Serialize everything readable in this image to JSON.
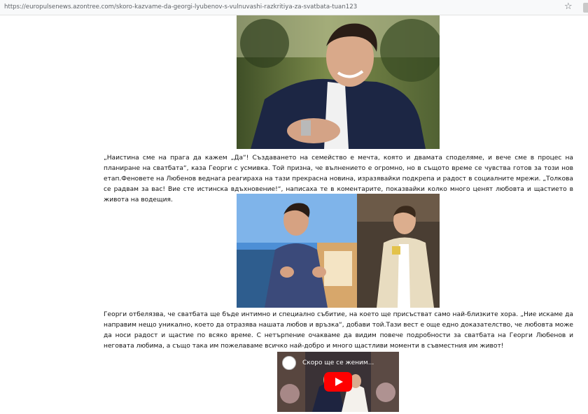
{
  "browser": {
    "url": "https://europulsenews.azontree.com/skoro-kazvame-da-georgi-lyubenov-s-vulnuvashi-razkritiya-za-svatbata-tuan123",
    "bookmark_icon": "star-icon"
  },
  "article": {
    "paragraph_1": "„Наистина сме на прага да кажем „Да“! Създаването на семейство е мечта, която и двамата споделяме, и вече сме в процес на планиране на сватбата“, каза Георги с усмивка. Той призна, че вълнението е огромно, но в същото време се чувства готов за този нов етап.Феновете на Любенов веднага реагираха на тази прекрасна новина, изразявайки подкрепа и радост в социалните мрежи. „Толкова се радвам за вас! Вие сте истинска вдъхновение!“, написаха те в коментарите, показвайки колко много ценят любовта и щастието в живота на водещия.",
    "paragraph_2": "Георги отбелязва, че сватбата ще бъде интимно и специално събитие, на което ще присъстват само най-близките хора. „Ние искаме да направим нещо уникално, което да отразява нашата любов и връзка“, добави той.Тази вест е още едно доказателство, че любовта може да носи радост и щастие по всяко време. С нетърпение очакваме да видим повече подробности за сватбата на Георги Любенов и неговата любима, а също така им пожелаваме всичко най-добро и много щастливи моменти в съвместния им живот!"
  },
  "video": {
    "title": "Скоро ще се женим...",
    "play_icon": "play-icon",
    "accent": "#ff0000"
  }
}
